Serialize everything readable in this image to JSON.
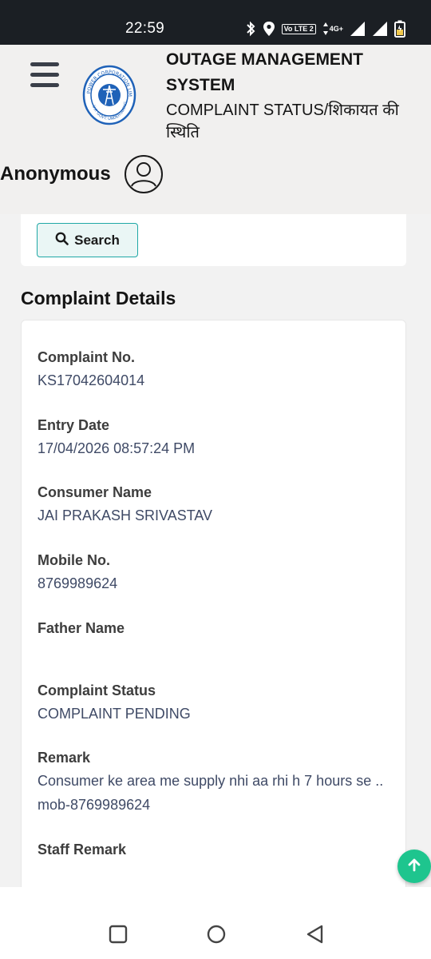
{
  "status_bar": {
    "time": "22:59",
    "volte_label": "Vo LTE 2",
    "network_label": "4G+",
    "icons": [
      "bluetooth-icon",
      "location-icon",
      "volte-icon",
      "data-arrows-icon",
      "signal-icon",
      "signal-icon",
      "battery-charging-icon"
    ]
  },
  "header": {
    "menu_icon": "hamburger-menu-icon",
    "logo_text_top": "POWER CORPORATION LIMITED",
    "logo_text_bottom": "U.P. GOVT. UNDERTAKING",
    "title_line1": "OUTAGE MANAGEMENT",
    "title_line2": "SYSTEM",
    "subtitle": "COMPLAINT STATUS/शिकायत की स्थिति",
    "user_name": "Anonymous",
    "user_icon": "user-avatar-icon"
  },
  "search": {
    "button_label": "Search",
    "icon": "search-icon"
  },
  "details": {
    "section_title": "Complaint Details",
    "fields": [
      {
        "label": "Complaint No.",
        "value": "KS17042604014"
      },
      {
        "label": "Entry Date",
        "value": "17/04/2026 08:57:24 PM"
      },
      {
        "label": "Consumer Name",
        "value": "JAI PRAKASH SRIVASTAV"
      },
      {
        "label": "Mobile No.",
        "value": "8769989624"
      },
      {
        "label": "Father Name",
        "value": ""
      },
      {
        "label": "Complaint Status",
        "value": "COMPLAINT PENDING"
      },
      {
        "label": "Remark",
        "value": "Consumer ke area me supply nhi aa rhi h 7 hours se .. mob-8769989624"
      },
      {
        "label": "Staff Remark",
        "value": ""
      }
    ]
  },
  "fab": {
    "icon": "arrow-up-icon"
  },
  "nav_bar": {
    "icons": [
      "recent-apps-icon",
      "home-icon",
      "back-icon"
    ]
  },
  "colors": {
    "status_bar_bg": "#1b1f24",
    "header_bg": "#f1f0ef",
    "accent_teal": "#1fa8a6",
    "fab_green": "#1ec58e",
    "value_text": "#3f4a66",
    "logo_blue": "#1f62b8"
  }
}
